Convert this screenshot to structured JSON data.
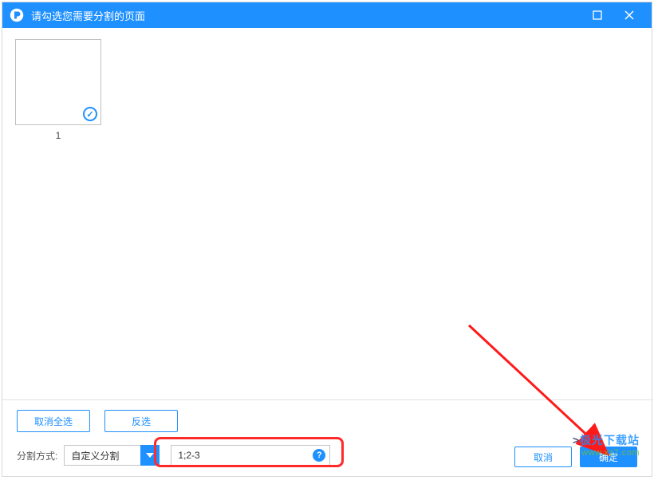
{
  "title": "请勾选您需要分割的页面",
  "page_thumb": {
    "number": "1",
    "selected": true
  },
  "footer": {
    "deselect_all": "取消全选",
    "invert": "反选",
    "split_label": "分割方式:",
    "split_mode": "自定义分割",
    "range_value": "1;2-3",
    "cancel": "取消",
    "confirm": "确定"
  },
  "watermark": {
    "line1_prefix": ">",
    "line1_main": "极光下载站",
    "line2": "www.xz7.com"
  }
}
